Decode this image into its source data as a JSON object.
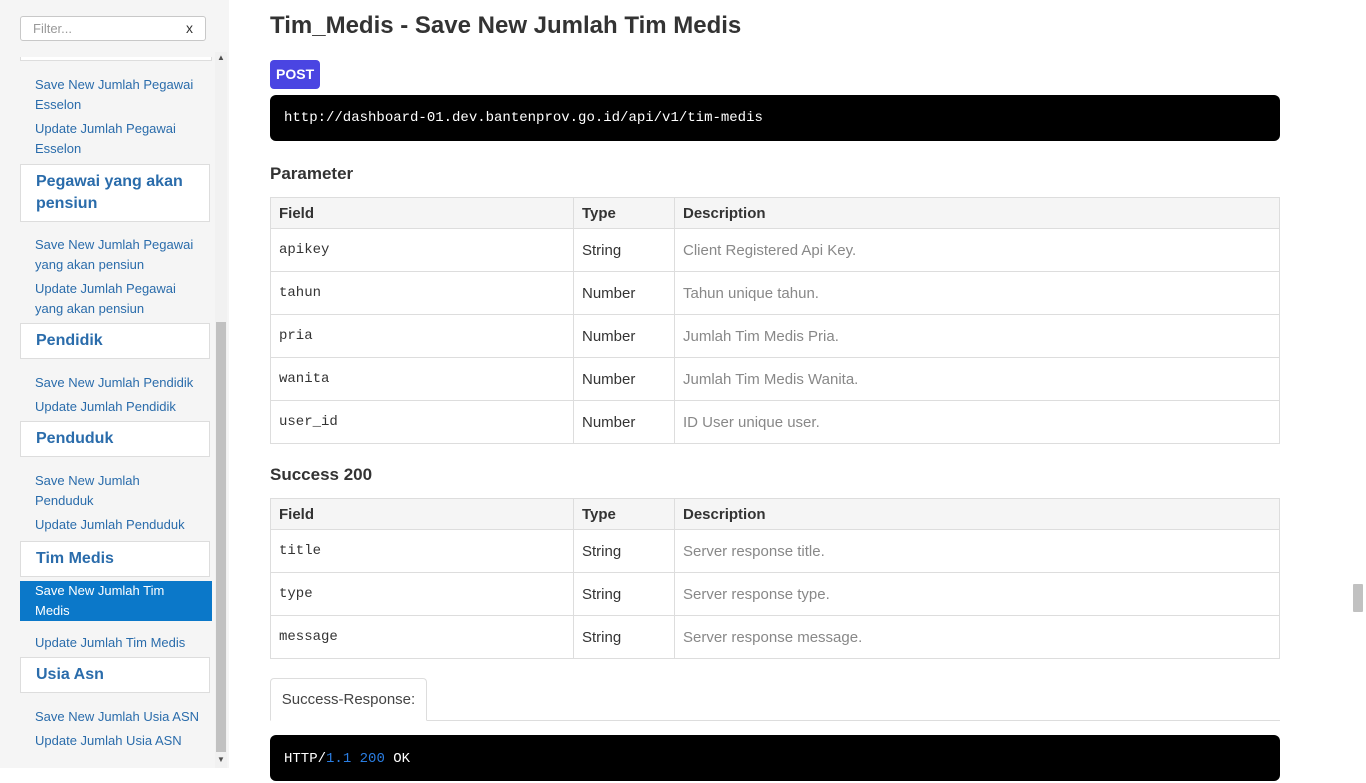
{
  "sidebar": {
    "filter": {
      "placeholder": "Filter...",
      "clear_label": "x"
    },
    "items": [
      {
        "kind": "link",
        "label": "Save New Jumlah Pegawai Esselon",
        "lines": [
          "Save New Jumlah Pegawai",
          "Esselon"
        ]
      },
      {
        "kind": "link",
        "label": "Update Jumlah Pegawai Esselon",
        "lines": [
          "Update Jumlah Pegawai",
          "Esselon"
        ]
      },
      {
        "kind": "header",
        "label": "Pegawai yang akan pensiun",
        "lines": [
          "Pegawai yang akan",
          "pensiun"
        ]
      },
      {
        "kind": "link",
        "label": "Save New Jumlah Pegawai yang akan pensiun",
        "lines": [
          "Save New Jumlah Pegawai",
          "yang akan pensiun"
        ]
      },
      {
        "kind": "link",
        "label": "Update Jumlah Pegawai yang akan pensiun",
        "lines": [
          "Update Jumlah Pegawai",
          "yang akan pensiun"
        ]
      },
      {
        "kind": "header",
        "label": "Pendidik",
        "lines": [
          "Pendidik"
        ]
      },
      {
        "kind": "link",
        "label": "Save New Jumlah Pendidik",
        "lines": [
          "Save New Jumlah Pendidik"
        ]
      },
      {
        "kind": "link",
        "label": "Update Jumlah Pendidik",
        "lines": [
          "Update Jumlah Pendidik"
        ]
      },
      {
        "kind": "header",
        "label": "Penduduk",
        "lines": [
          "Penduduk"
        ]
      },
      {
        "kind": "link",
        "label": "Save New Jumlah Penduduk",
        "lines": [
          "Save New Jumlah",
          "Penduduk"
        ]
      },
      {
        "kind": "link",
        "label": "Update Jumlah Penduduk",
        "lines": [
          "Update Jumlah Penduduk"
        ]
      },
      {
        "kind": "header",
        "label": "Tim Medis",
        "lines": [
          "Tim Medis"
        ]
      },
      {
        "kind": "link",
        "label": "Save New Jumlah Tim Medis",
        "lines": [
          "Save New Jumlah Tim",
          "Medis"
        ],
        "active": true
      },
      {
        "kind": "link",
        "label": "Update Jumlah Tim Medis",
        "lines": [
          "Update Jumlah Tim Medis"
        ]
      },
      {
        "kind": "header",
        "label": "Usia Asn",
        "lines": [
          "Usia Asn"
        ]
      },
      {
        "kind": "link",
        "label": "Save New Jumlah Usia ASN",
        "lines": [
          "Save New Jumlah Usia ASN"
        ]
      },
      {
        "kind": "link",
        "label": "Update Jumlah Usia ASN",
        "lines": [
          "Update Jumlah Usia ASN"
        ]
      }
    ]
  },
  "main": {
    "title": "Tim_Medis - Save New Jumlah Tim Medis",
    "method": "POST",
    "url": "http://dashboard-01.dev.bantenprov.go.id/api/v1/tim-medis",
    "parameter": {
      "title": "Parameter",
      "headers": [
        "Field",
        "Type",
        "Description"
      ],
      "rows": [
        [
          "apikey",
          "String",
          "Client Registered Api Key."
        ],
        [
          "tahun",
          "Number",
          "Tahun unique tahun."
        ],
        [
          "pria",
          "Number",
          "Jumlah Tim Medis Pria."
        ],
        [
          "wanita",
          "Number",
          "Jumlah Tim Medis Wanita."
        ],
        [
          "user_id",
          "Number",
          "ID User unique user."
        ]
      ]
    },
    "success": {
      "title": "Success 200",
      "headers": [
        "Field",
        "Type",
        "Description"
      ],
      "rows": [
        [
          "title",
          "String",
          "Server response title."
        ],
        [
          "type",
          "String",
          "Server response type."
        ],
        [
          "message",
          "String",
          "Server response message."
        ]
      ]
    },
    "response_tab": "Success-Response:",
    "response_code": {
      "protocol": "HTTP/",
      "version": "1.1",
      "status": "200",
      "text": "OK"
    }
  },
  "colors": {
    "link": "#2a6cab",
    "active_bg": "#0b78c9",
    "method_badge": "#4a45e2",
    "code_bg": "#000000"
  }
}
